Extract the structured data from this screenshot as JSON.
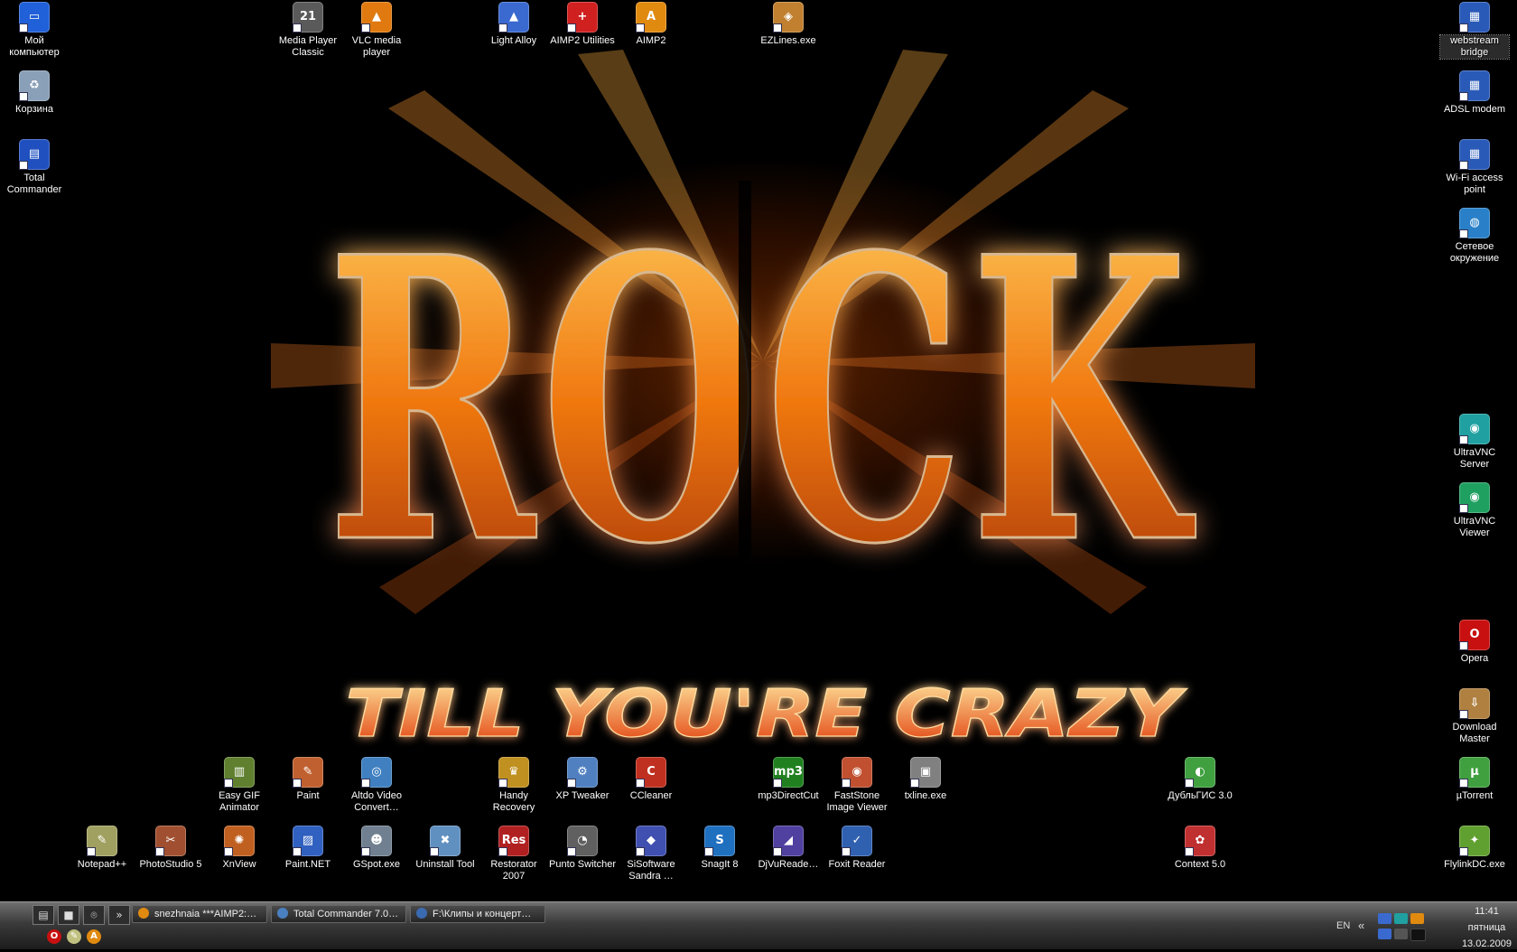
{
  "desktop_icons": [
    {
      "id": "my-computer",
      "label": "Мой компьютер",
      "glyph": "▭",
      "color": "#2060d8"
    },
    {
      "id": "recycle-bin",
      "label": "Корзина",
      "glyph": "♻",
      "color": "#8aa0b8"
    },
    {
      "id": "total-commander",
      "label": "Total Commander",
      "glyph": "▤",
      "color": "#2050c0"
    },
    {
      "id": "media-player-classic",
      "label": "Media Player Classic",
      "glyph": "21",
      "color": "#5a5a5a"
    },
    {
      "id": "vlc",
      "label": "VLC media player",
      "glyph": "▲",
      "color": "#e07a10"
    },
    {
      "id": "light-alloy",
      "label": "Light Alloy",
      "glyph": "▲",
      "color": "#3a6ad0"
    },
    {
      "id": "aimp2-utilities",
      "label": "AIMP2 Utilities",
      "glyph": "+",
      "color": "#d02020"
    },
    {
      "id": "aimp2",
      "label": "AIMP2",
      "glyph": "A",
      "color": "#e08a10"
    },
    {
      "id": "ezlines",
      "label": "EZLines.exe",
      "glyph": "◈",
      "color": "#c08030"
    },
    {
      "id": "webstream-bridge",
      "label": "webstream bridge",
      "glyph": "▦",
      "color": "#2a5ab8"
    },
    {
      "id": "adsl-modem",
      "label": "ADSL modem",
      "glyph": "▦",
      "color": "#2a5ab8"
    },
    {
      "id": "wifi-access-point",
      "label": "Wi-Fi access point",
      "glyph": "▦",
      "color": "#2a5ab8"
    },
    {
      "id": "network-places",
      "label": "Сетевое окружение",
      "glyph": "◍",
      "color": "#2a80c8"
    },
    {
      "id": "ultravnc-server",
      "label": "UltraVNC Server",
      "glyph": "◉",
      "color": "#20a0a0"
    },
    {
      "id": "ultravnc-viewer",
      "label": "UltraVNC Viewer",
      "glyph": "◉",
      "color": "#20a060"
    },
    {
      "id": "opera",
      "label": "Opera",
      "glyph": "O",
      "color": "#c81010"
    },
    {
      "id": "download-master",
      "label": "Download Master",
      "glyph": "⇩",
      "color": "#b08040"
    },
    {
      "id": "utorrent",
      "label": "µTorrent",
      "glyph": "µ",
      "color": "#40a040"
    },
    {
      "id": "flylinkdc",
      "label": "FlylinkDC.exe",
      "glyph": "✦",
      "color": "#60a030"
    },
    {
      "id": "easy-gif-animator",
      "label": "Easy GIF Animator",
      "glyph": "▥",
      "color": "#608030"
    },
    {
      "id": "paint",
      "label": "Paint",
      "glyph": "✎",
      "color": "#c06030"
    },
    {
      "id": "altdo-video",
      "label": "Altdo Video Convert…",
      "glyph": "◎",
      "color": "#4080c0"
    },
    {
      "id": "handy-recovery",
      "label": "Handy Recovery",
      "glyph": "♛",
      "color": "#c09020"
    },
    {
      "id": "xp-tweaker",
      "label": "XP Tweaker",
      "glyph": "⚙",
      "color": "#5080c0"
    },
    {
      "id": "ccleaner",
      "label": "CCleaner",
      "glyph": "C",
      "color": "#c03020"
    },
    {
      "id": "mp3directcut",
      "label": "mp3DirectCut",
      "glyph": "mp3",
      "color": "#208020"
    },
    {
      "id": "faststone",
      "label": "FastStone Image Viewer",
      "glyph": "◉",
      "color": "#c05030"
    },
    {
      "id": "txline",
      "label": "txline.exe",
      "glyph": "▣",
      "color": "#808080"
    },
    {
      "id": "dublgis",
      "label": "ДубльГИС 3.0",
      "glyph": "◐",
      "color": "#40a040"
    },
    {
      "id": "notepadpp",
      "label": "Notepad++",
      "glyph": "✎",
      "color": "#a0a060"
    },
    {
      "id": "photostudio",
      "label": "PhotoStudio 5",
      "glyph": "✂",
      "color": "#a05030"
    },
    {
      "id": "xnview",
      "label": "XnView",
      "glyph": "✺",
      "color": "#c06020"
    },
    {
      "id": "paint-net",
      "label": "Paint.NET",
      "glyph": "▨",
      "color": "#3060c0"
    },
    {
      "id": "gspot",
      "label": "GSpot.exe",
      "glyph": "☻",
      "color": "#708090"
    },
    {
      "id": "uninstall-tool",
      "label": "Uninstall Tool",
      "glyph": "✖",
      "color": "#6090c0"
    },
    {
      "id": "restorator",
      "label": "Restorator 2007",
      "glyph": "Res",
      "color": "#b02020"
    },
    {
      "id": "punto-switcher",
      "label": "Punto Switcher",
      "glyph": "◔",
      "color": "#606060"
    },
    {
      "id": "sisoftware",
      "label": "SiSoftware Sandra …",
      "glyph": "◆",
      "color": "#4050b0"
    },
    {
      "id": "snagit",
      "label": "SnagIt 8",
      "glyph": "S",
      "color": "#2070c0"
    },
    {
      "id": "djvureader",
      "label": "DjVuReade…",
      "glyph": "◢",
      "color": "#5040a0"
    },
    {
      "id": "foxit-reader",
      "label": "Foxit Reader",
      "glyph": "✓",
      "color": "#3060b0"
    },
    {
      "id": "context",
      "label": "Context 5.0",
      "glyph": "✿",
      "color": "#c03030"
    }
  ],
  "wallpaper": {
    "headline": "ROCK",
    "tagline": "TILL YOU'RE CRAZY"
  },
  "taskbar": {
    "quick_launch": [
      "▤",
      "■",
      "⌾",
      "»"
    ],
    "tasks": [
      {
        "label": "snezhnaia ***AIMP2:…",
        "color": "#e08a10"
      },
      {
        "label": "Total Commander 7.0…",
        "color": "#4a80c0"
      },
      {
        "label": "F:\\Клипы и концерт…",
        "color": "#3a6ab0"
      }
    ],
    "quick_launch_row2": [
      {
        "glyph": "O",
        "color": "#c81010"
      },
      {
        "glyph": "✎",
        "color": "#c0c080"
      },
      {
        "glyph": "A",
        "color": "#e08a10"
      }
    ],
    "tray": {
      "language": "EN",
      "chevron": "«",
      "time": "11:41",
      "weekday": "пятница",
      "date": "13.02.2009"
    }
  }
}
